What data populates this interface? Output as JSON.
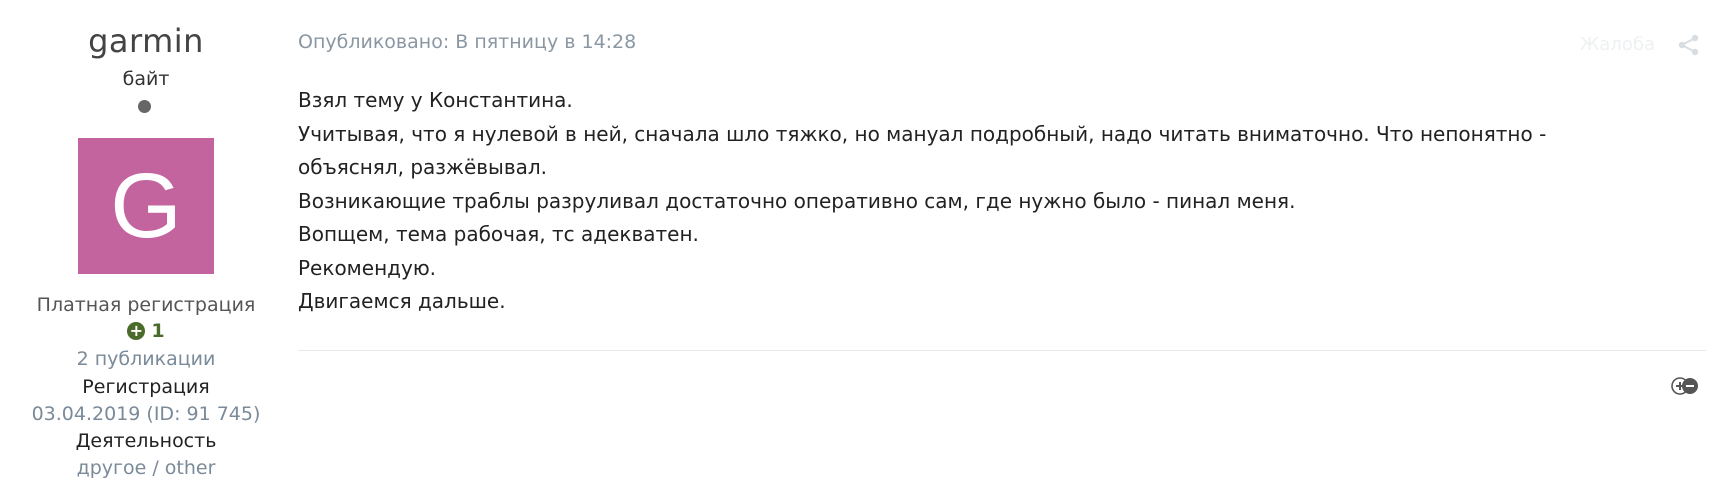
{
  "author": {
    "name": "garmin",
    "title": "байт",
    "avatar_letter": "G",
    "avatar_color": "#c4649f",
    "group": "Платная регистрация",
    "reputation": "1",
    "reputation_icon": "plus-circle-icon",
    "posts": "2 публикации",
    "registration_label": "Регистрация",
    "registration_value": "03.04.2019 (ID: 91 745)",
    "activity_label": "Деятельность",
    "activity_value": "другое / other"
  },
  "post": {
    "meta": "Опубликовано: В пятницу в 14:28",
    "report_label": "Жалоба",
    "share_icon": "share-icon",
    "react_icon": "reaction-icon",
    "lines": [
      "Взял тему у Константина.",
      "Учитывая, что я нулевой в ней, сначала шло тяжко, но мануал подробный, надо читать вниматочно. Что непонятно -",
      "объяснял, разжёвывал.",
      "Возникающие траблы разруливал достаточно оперативно сам, где нужно было - пинал меня.",
      "Вопщем, тема рабочая, тс адекватен.",
      "Рекомендую.",
      "Двигаемся дальше."
    ]
  },
  "colors": {
    "reputation": "#4a6b2a",
    "muted": "#7a8a99"
  }
}
